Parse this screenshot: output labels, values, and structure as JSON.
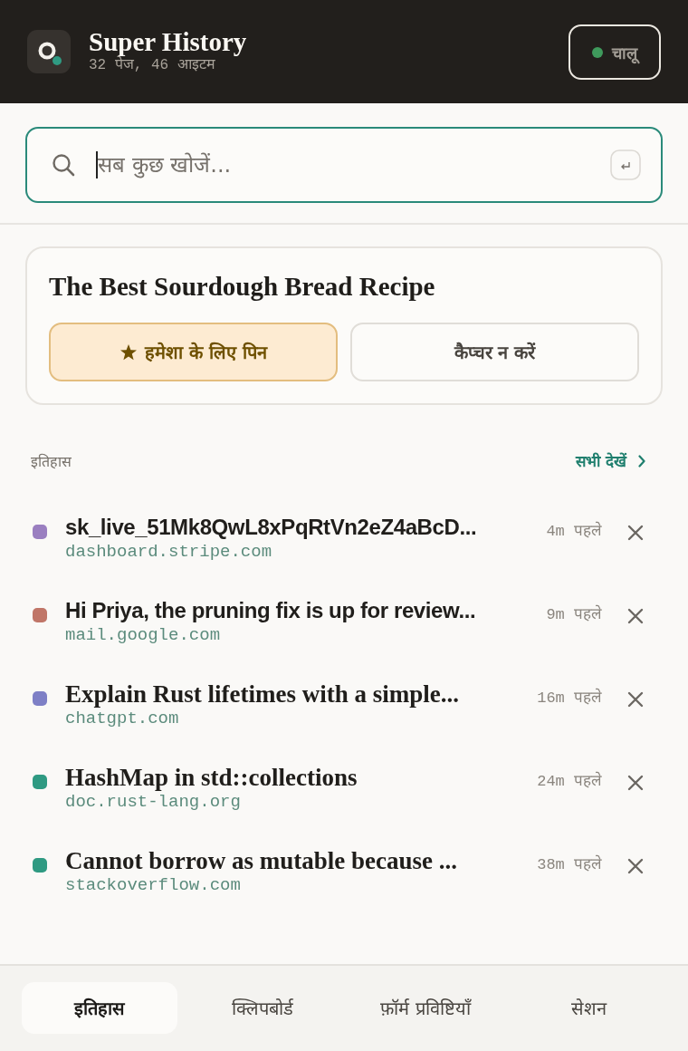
{
  "header": {
    "title": "Super History",
    "subtitle": "32 पेज, 46 आइटम",
    "status": {
      "label": "चालू",
      "on": true
    }
  },
  "search": {
    "placeholder": "सब कुछ खोजें...",
    "focused": true
  },
  "current_page": {
    "title": "The Best Sourdough Bread Recipe",
    "actions": [
      {
        "label": "हमेशा के लिए पिन",
        "kind": "pin"
      },
      {
        "label": "कैप्चर न करें",
        "kind": "plain"
      }
    ]
  },
  "history": {
    "heading": "इतिहास",
    "see_all": "सभी देखें",
    "items": [
      {
        "kind": "snippet",
        "title": "sk_live_51Mk8QwL8xPqRtVn2eZ4aBcD...",
        "domain": "dashboard.stripe.com",
        "time": "4m पहले",
        "color": "#9a7fc0"
      },
      {
        "kind": "snippet",
        "title": "Hi Priya, the pruning fix is up for review...",
        "domain": "mail.google.com",
        "time": "9m पहले",
        "color": "#c07668"
      },
      {
        "kind": "page",
        "title": "Explain Rust lifetimes with a simple...",
        "domain": "chatgpt.com",
        "time": "16m पहले",
        "color": "#7e80c6"
      },
      {
        "kind": "page",
        "title": "HashMap in std::collections",
        "domain": "doc.rust-lang.org",
        "time": "24m पहले",
        "color": "#2f9a82"
      },
      {
        "kind": "page",
        "title": "Cannot borrow as mutable because ...",
        "domain": "stackoverflow.com",
        "time": "38m पहले",
        "color": "#2f9a82"
      }
    ]
  },
  "tabs": [
    {
      "label": "इतिहास",
      "selected": true
    },
    {
      "label": "क्लिपबोर्ड",
      "selected": false
    },
    {
      "label": "फ़ॉर्म प्रविष्टियाँ",
      "selected": false
    },
    {
      "label": "सेशन",
      "selected": false
    }
  ]
}
